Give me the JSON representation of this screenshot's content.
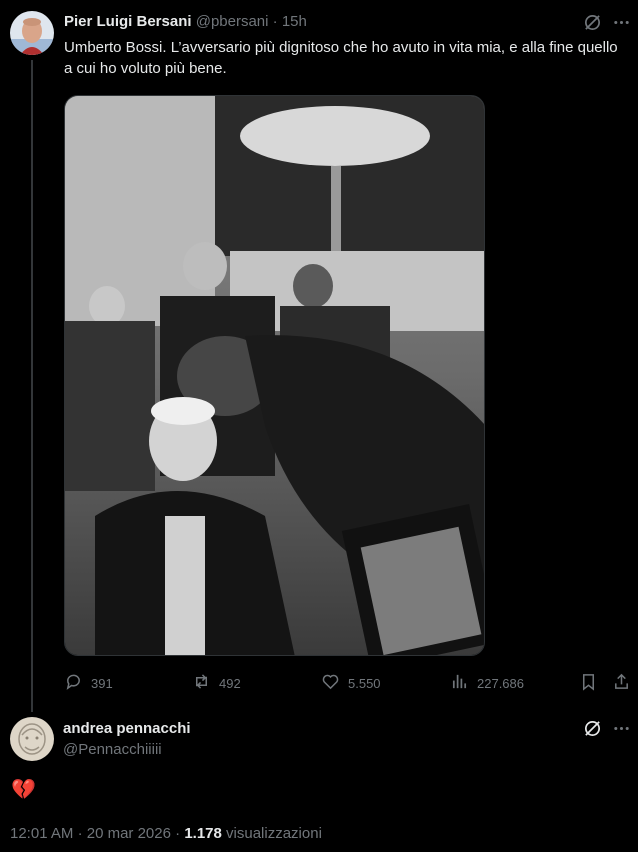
{
  "tweet": {
    "author_name": "Pier Luigi Bersani",
    "handle": "@pbersani",
    "separator": "·",
    "time": "15h",
    "text": "Umberto Bossi. L’avversario più dignitoso che ho avuto in vita mia, e alla fine quello a cui ho voluto più bene.",
    "stats": {
      "replies": "391",
      "reposts": "492",
      "likes": "5.550",
      "views": "227.686"
    }
  },
  "reply": {
    "author_name": "andrea pennacchi",
    "handle": "@Pennacchiiiii",
    "emoji": "💔",
    "time": "12:01 AM",
    "separator": "·",
    "date": "20 mar 2026",
    "separator2": "·",
    "views_count": "1.178",
    "views_label": "visualizzazioni"
  },
  "icons": {
    "grok": "grok-icon",
    "more": "more-icon",
    "reply": "reply-icon",
    "repost": "repost-icon",
    "like": "like-icon",
    "views": "views-icon",
    "bookmark": "bookmark-icon",
    "share": "share-icon"
  },
  "colors": {
    "background": "#000000",
    "text": "#e7e9ea",
    "muted": "#71767b",
    "divider": "#333639",
    "broken_heart": "#f4212e"
  }
}
